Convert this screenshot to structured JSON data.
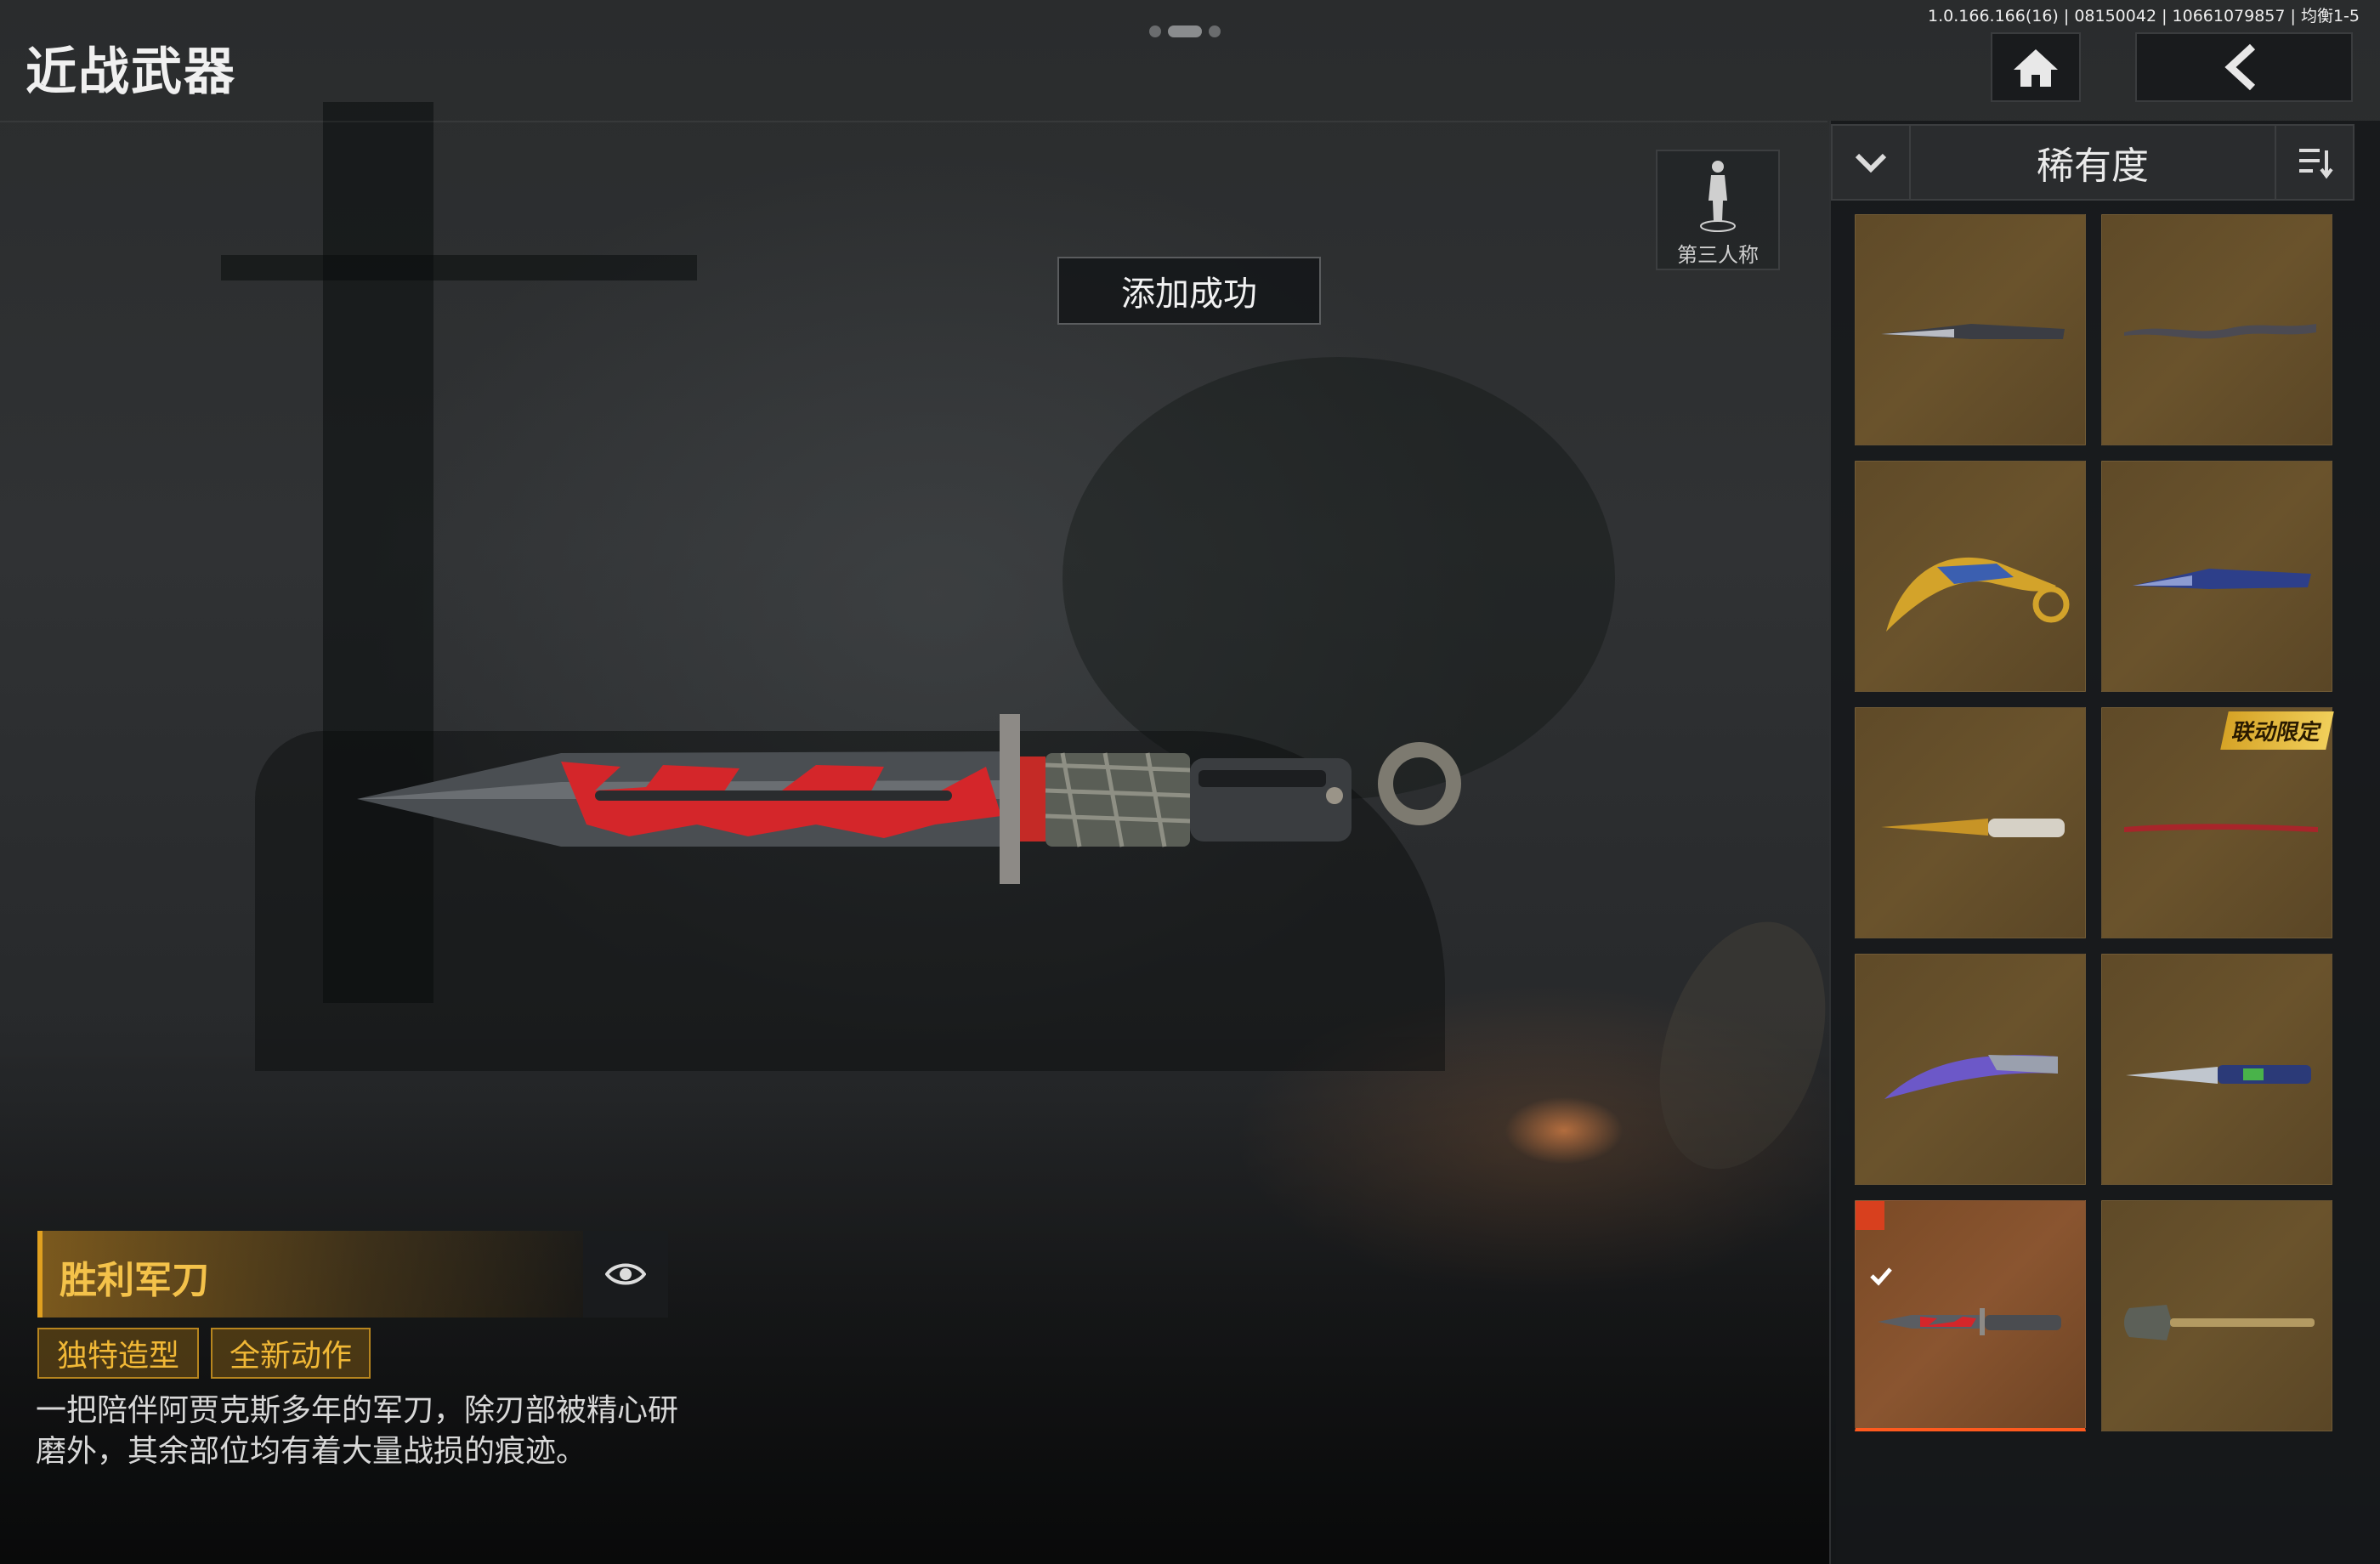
{
  "status": {
    "text": "1.0.166.166(16) | 08150042 | 10661079857 | 均衡1-5"
  },
  "header": {
    "title": "近战武器"
  },
  "view_toggle": {
    "label": "第三人称"
  },
  "toast": {
    "text": "添加成功"
  },
  "weapon": {
    "name": "胜利军刀",
    "tags": [
      "独特造型",
      "全新动作"
    ],
    "description": "一把陪伴阿贾克斯多年的军刀，除刃部被精心研磨外，其余部位均有着大量战损的痕迹。"
  },
  "sort": {
    "label": "稀有度"
  },
  "items": [
    {
      "icon": "serrated-knife-icon",
      "badge": "",
      "selected": false
    },
    {
      "icon": "wavy-dagger-icon",
      "badge": "",
      "selected": false
    },
    {
      "icon": "karambit-icon",
      "badge": "",
      "selected": false
    },
    {
      "icon": "blue-knife-icon",
      "badge": "",
      "selected": false
    },
    {
      "icon": "gold-knife-icon",
      "badge": "",
      "selected": false
    },
    {
      "icon": "red-katana-icon",
      "badge": "联动限定",
      "selected": false
    },
    {
      "icon": "purple-blade-icon",
      "badge": "",
      "selected": false
    },
    {
      "icon": "green-tactical-knife-icon",
      "badge": "",
      "selected": false
    },
    {
      "icon": "victory-knife-icon",
      "badge": "",
      "selected": true
    },
    {
      "icon": "shovel-icon",
      "badge": "",
      "selected": false
    }
  ],
  "colors": {
    "accent": "#f1b836",
    "selected_border": "#ff5a1e",
    "cell_bg": "#6a532c"
  }
}
